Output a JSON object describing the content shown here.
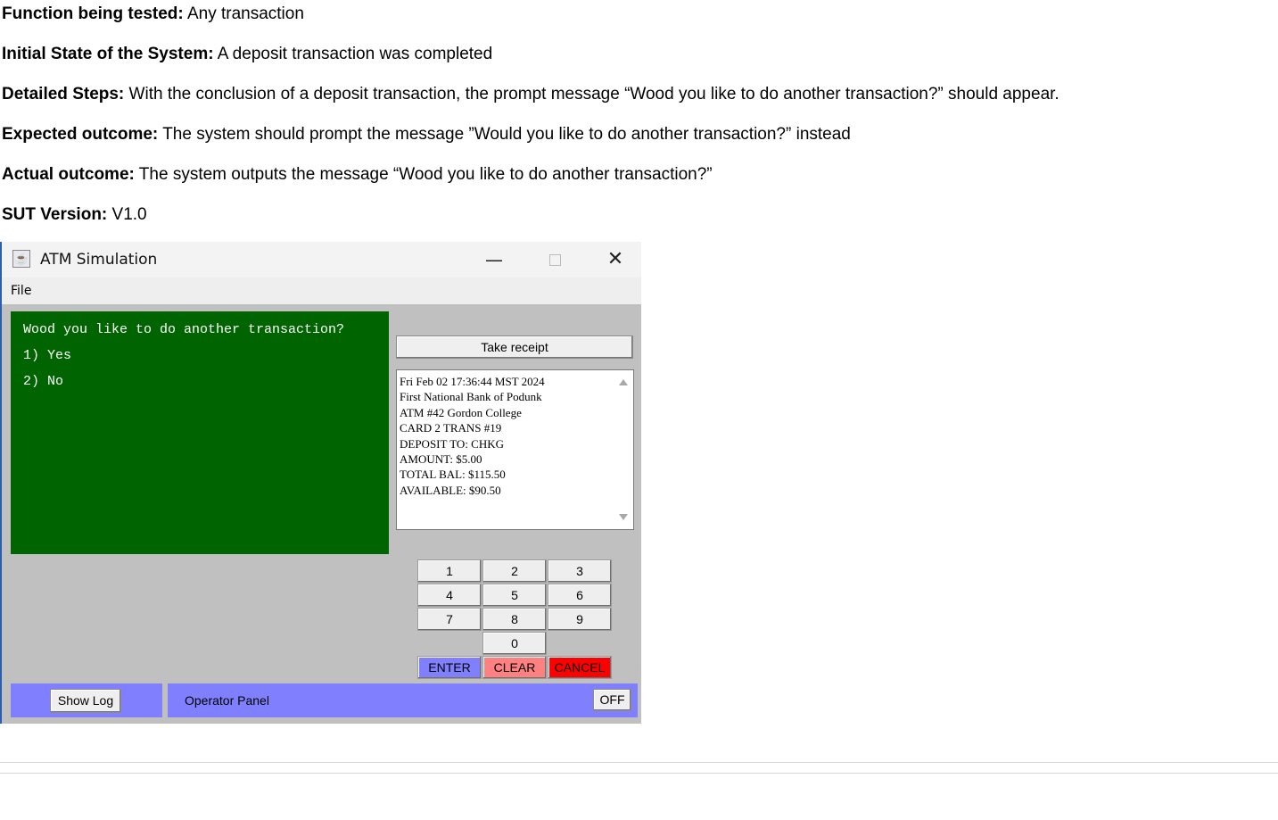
{
  "doc": {
    "function_label": "Function being tested:",
    "function_value": " Any transaction",
    "initial_label": "Initial State of the System:",
    "initial_value": " A deposit transaction was completed",
    "steps_label": "Detailed Steps:",
    "steps_value": " With the conclusion of a deposit transaction, the prompt message “Wood you like to do another transaction?” should appear.",
    "expected_label": "Expected outcome:",
    "expected_value": " The system should prompt the message ”Would you like to do another transaction?” instead",
    "actual_label": "Actual outcome:",
    "actual_value": " The system outputs the message “Wood you like to do another transaction?”",
    "version_label": "SUT Version:",
    "version_value": " V1.0"
  },
  "window": {
    "title": "ATM Simulation",
    "app_icon": "java-cup-icon",
    "min_glyph": "—",
    "close_glyph": "✕"
  },
  "menu": {
    "file": "File"
  },
  "screen": {
    "lines": [
      "Wood you like to do another transaction?",
      "1) Yes",
      "2) No"
    ],
    "bg_color": "#006400"
  },
  "receipt": {
    "button_label": "Take receipt",
    "text": "Fri Feb 02 17:36:44 MST 2024\nFirst National Bank of Podunk\nATM #42 Gordon College\nCARD 2 TRANS #19\nDEPOSIT TO: CHKG\nAMOUNT: $5.00\nTOTAL BAL: $115.50\nAVAILABLE: $90.50"
  },
  "keypad": {
    "digits": [
      "1",
      "2",
      "3",
      "4",
      "5",
      "6",
      "7",
      "8",
      "9",
      "0"
    ],
    "enter": "ENTER",
    "clear": "CLEAR",
    "cancel": "CANCEL",
    "enter_color": "#8080ff",
    "clear_color": "#ff8080",
    "cancel_color": "#ff0000"
  },
  "operator": {
    "show_log": "Show Log",
    "label": "Operator Panel",
    "off": "OFF",
    "panel_color": "#8080ff"
  }
}
